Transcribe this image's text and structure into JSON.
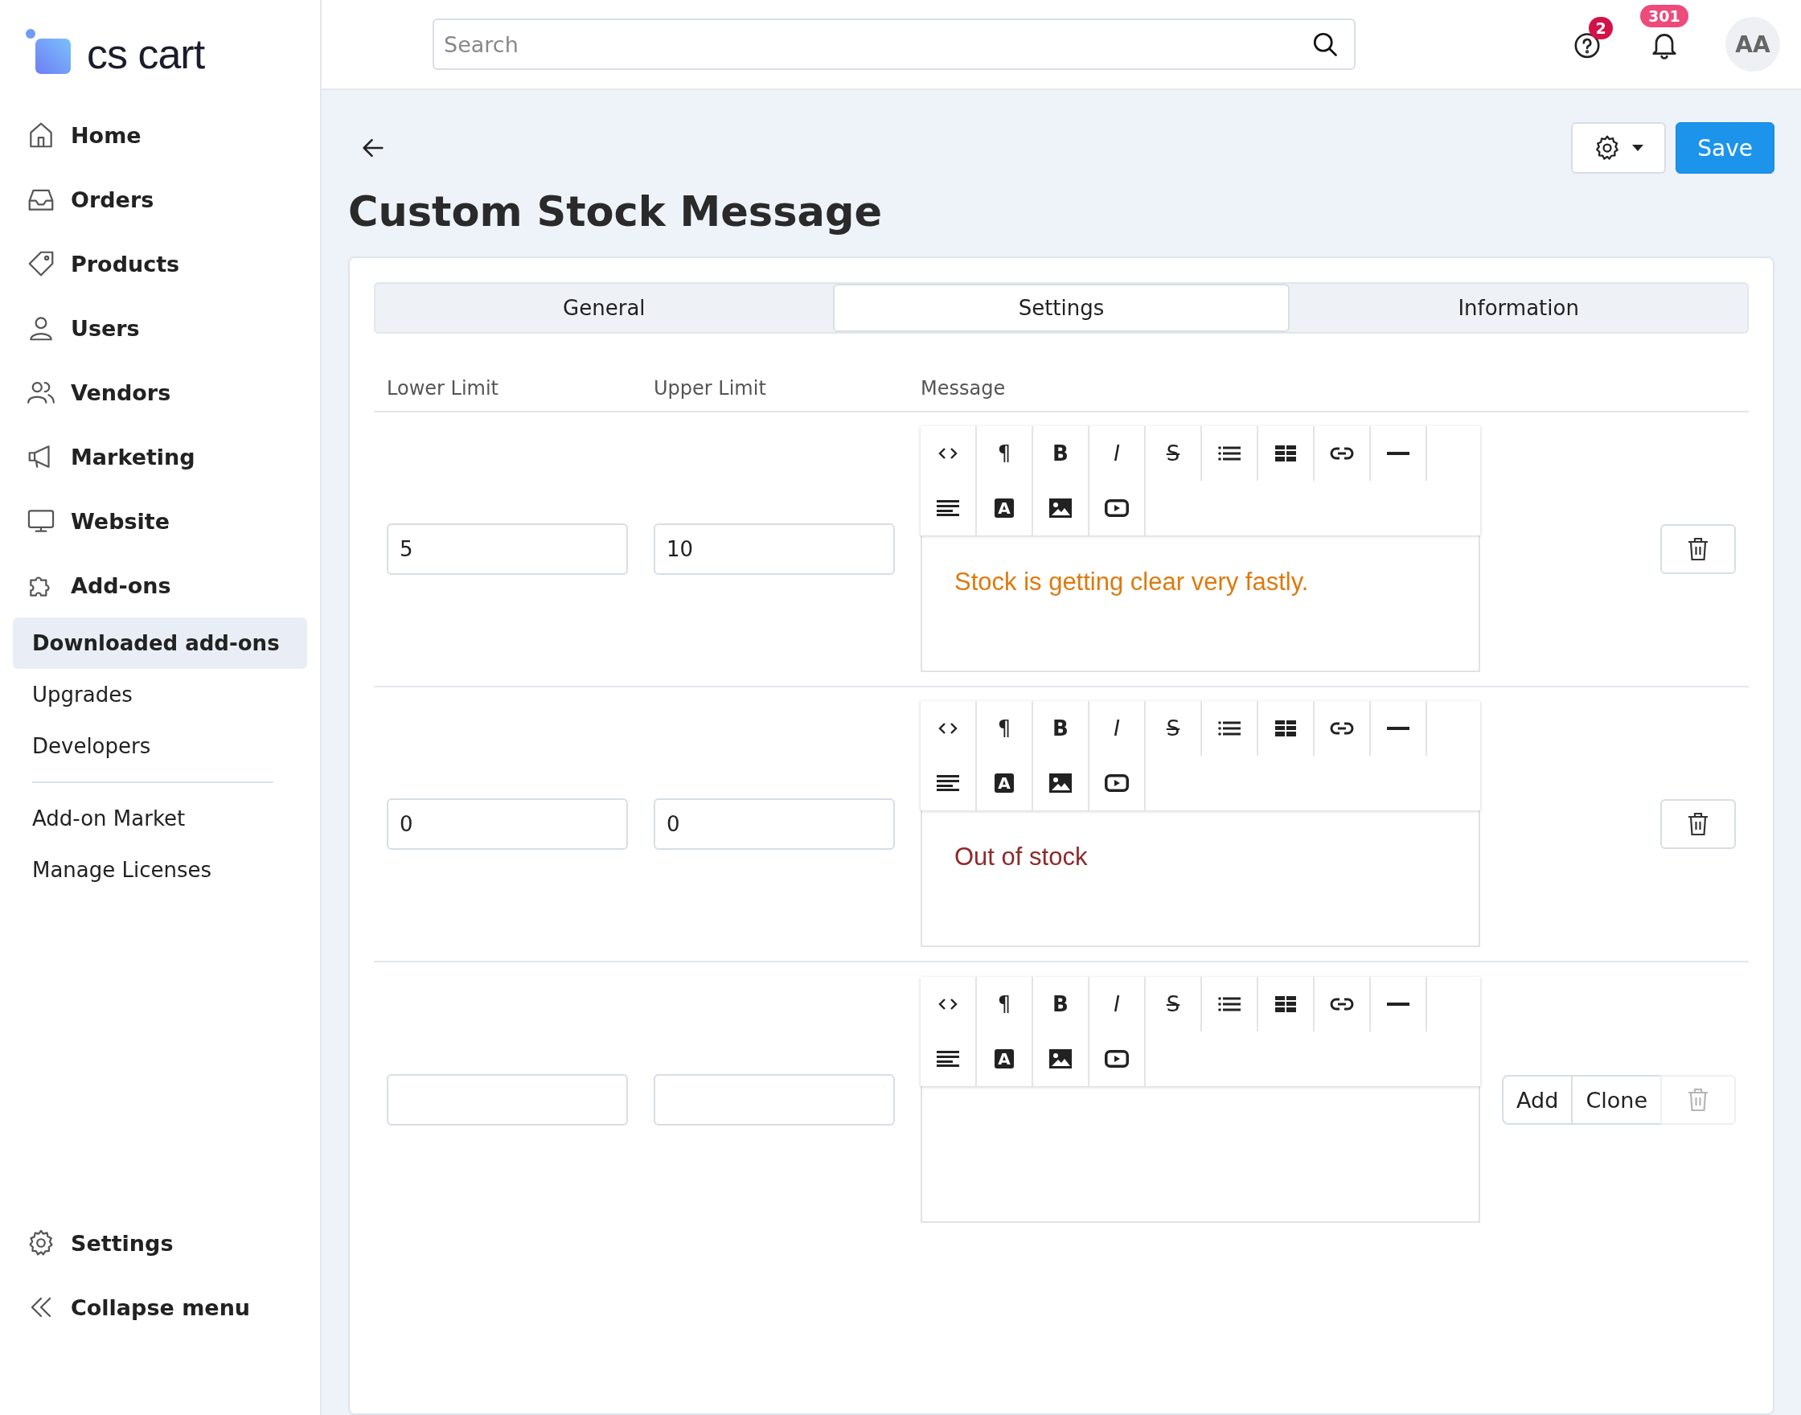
{
  "logo": {
    "text": "cs cart"
  },
  "sidebar": {
    "items": [
      {
        "label": "Home",
        "selected": false
      },
      {
        "label": "Orders",
        "selected": false
      },
      {
        "label": "Products",
        "selected": false
      },
      {
        "label": "Users",
        "selected": false
      },
      {
        "label": "Vendors",
        "selected": false
      },
      {
        "label": "Marketing",
        "selected": false
      },
      {
        "label": "Website",
        "selected": false
      },
      {
        "label": "Add-ons",
        "selected": false
      }
    ],
    "sub_items": [
      {
        "label": "Downloaded add-ons",
        "selected": true
      },
      {
        "label": "Upgrades",
        "selected": false
      },
      {
        "label": "Developers",
        "selected": false
      }
    ],
    "extra_items": [
      {
        "label": "Add-on Market",
        "selected": false
      },
      {
        "label": "Manage Licenses",
        "selected": false
      }
    ],
    "bottom_items": [
      {
        "label": "Settings"
      },
      {
        "label": "Collapse menu"
      }
    ]
  },
  "header": {
    "search": {
      "placeholder": "Search"
    },
    "help_badge": "2",
    "notifications_badge": "301",
    "avatar": "AA"
  },
  "page": {
    "title": "Custom Stock Message",
    "save_button": "Save"
  },
  "tabs": [
    {
      "label": "General",
      "selected": false
    },
    {
      "label": "Settings",
      "selected": true
    },
    {
      "label": "Information",
      "selected": false
    }
  ],
  "table": {
    "columns": [
      "Lower Limit",
      "Upper Limit",
      "Message"
    ],
    "rows": [
      {
        "lower": "5",
        "upper": "10",
        "message": {
          "text": "Stock is getting clear very fastly.",
          "color": "#dd7a0e"
        },
        "toolbar": [
          {
            "kind": "code"
          },
          {
            "kind": "char",
            "label": "¶"
          },
          {
            "kind": "bold",
            "label": "B"
          },
          {
            "kind": "italic",
            "label": "I"
          },
          {
            "kind": "strike",
            "label": "S"
          },
          {
            "kind": "list"
          },
          {
            "kind": "table"
          },
          {
            "kind": "link"
          },
          {
            "kind": "rule"
          },
          {
            "kind": "align"
          },
          {
            "kind": "fontcolor",
            "label": "A"
          },
          {
            "kind": "image"
          },
          {
            "kind": "video"
          }
        ],
        "delete_disabled": false
      },
      {
        "lower": "0",
        "upper": "0",
        "message": {
          "text": "Out of stock",
          "color": "#8e2a2a"
        },
        "toolbar": [
          {
            "kind": "code"
          },
          {
            "kind": "char",
            "label": "¶"
          },
          {
            "kind": "bold",
            "label": "B"
          },
          {
            "kind": "italic",
            "label": "I"
          },
          {
            "kind": "strike",
            "label": "S"
          },
          {
            "kind": "list"
          },
          {
            "kind": "table"
          },
          {
            "kind": "link"
          },
          {
            "kind": "rule"
          },
          {
            "kind": "align"
          },
          {
            "kind": "fontcolor",
            "label": "A"
          },
          {
            "kind": "image"
          },
          {
            "kind": "video"
          }
        ],
        "delete_disabled": false
      },
      {
        "toolbar": [
          {
            "kind": "code"
          },
          {
            "kind": "char",
            "label": "¶"
          },
          {
            "kind": "bold",
            "label": "B"
          },
          {
            "kind": "italic",
            "label": "I"
          },
          {
            "kind": "strike",
            "label": "S"
          },
          {
            "kind": "list"
          },
          {
            "kind": "table"
          },
          {
            "kind": "link"
          },
          {
            "kind": "rule"
          },
          {
            "kind": "align"
          },
          {
            "kind": "fontcolor",
            "label": "A"
          },
          {
            "kind": "image"
          },
          {
            "kind": "video"
          }
        ],
        "actions": [
          "Add",
          "Clone"
        ],
        "delete_disabled": true
      }
    ]
  }
}
